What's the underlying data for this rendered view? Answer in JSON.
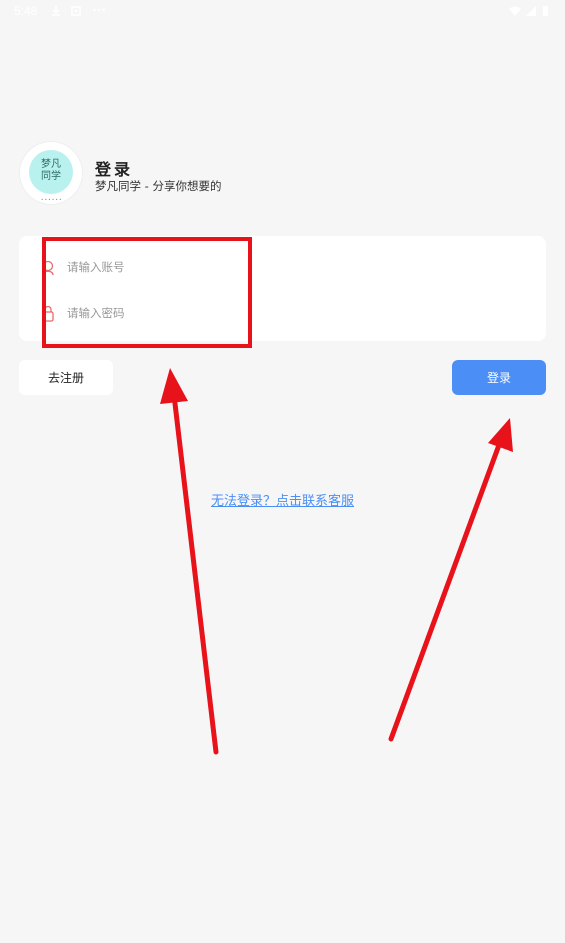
{
  "status_bar": {
    "time": "5:48",
    "icons": [
      "download-icon",
      "notification-icon",
      "wifi-icon",
      "signal-icon",
      "battery-icon"
    ]
  },
  "app": {
    "logo_text": "梦凡同学",
    "title": "登录",
    "subtitle": "梦凡同学 - 分享你想要的"
  },
  "form": {
    "account": {
      "placeholder": "请输入账号",
      "value": "",
      "icon": "user-icon"
    },
    "password": {
      "placeholder": "请输入密码",
      "value": "",
      "icon": "lock-icon"
    }
  },
  "buttons": {
    "register_label": "去注册",
    "login_label": "登录"
  },
  "help_link": "无法登录？点击联系客服",
  "colors": {
    "accent": "#4b8ff6",
    "background": "#f6f6f6",
    "annotation": "#e8121a"
  }
}
